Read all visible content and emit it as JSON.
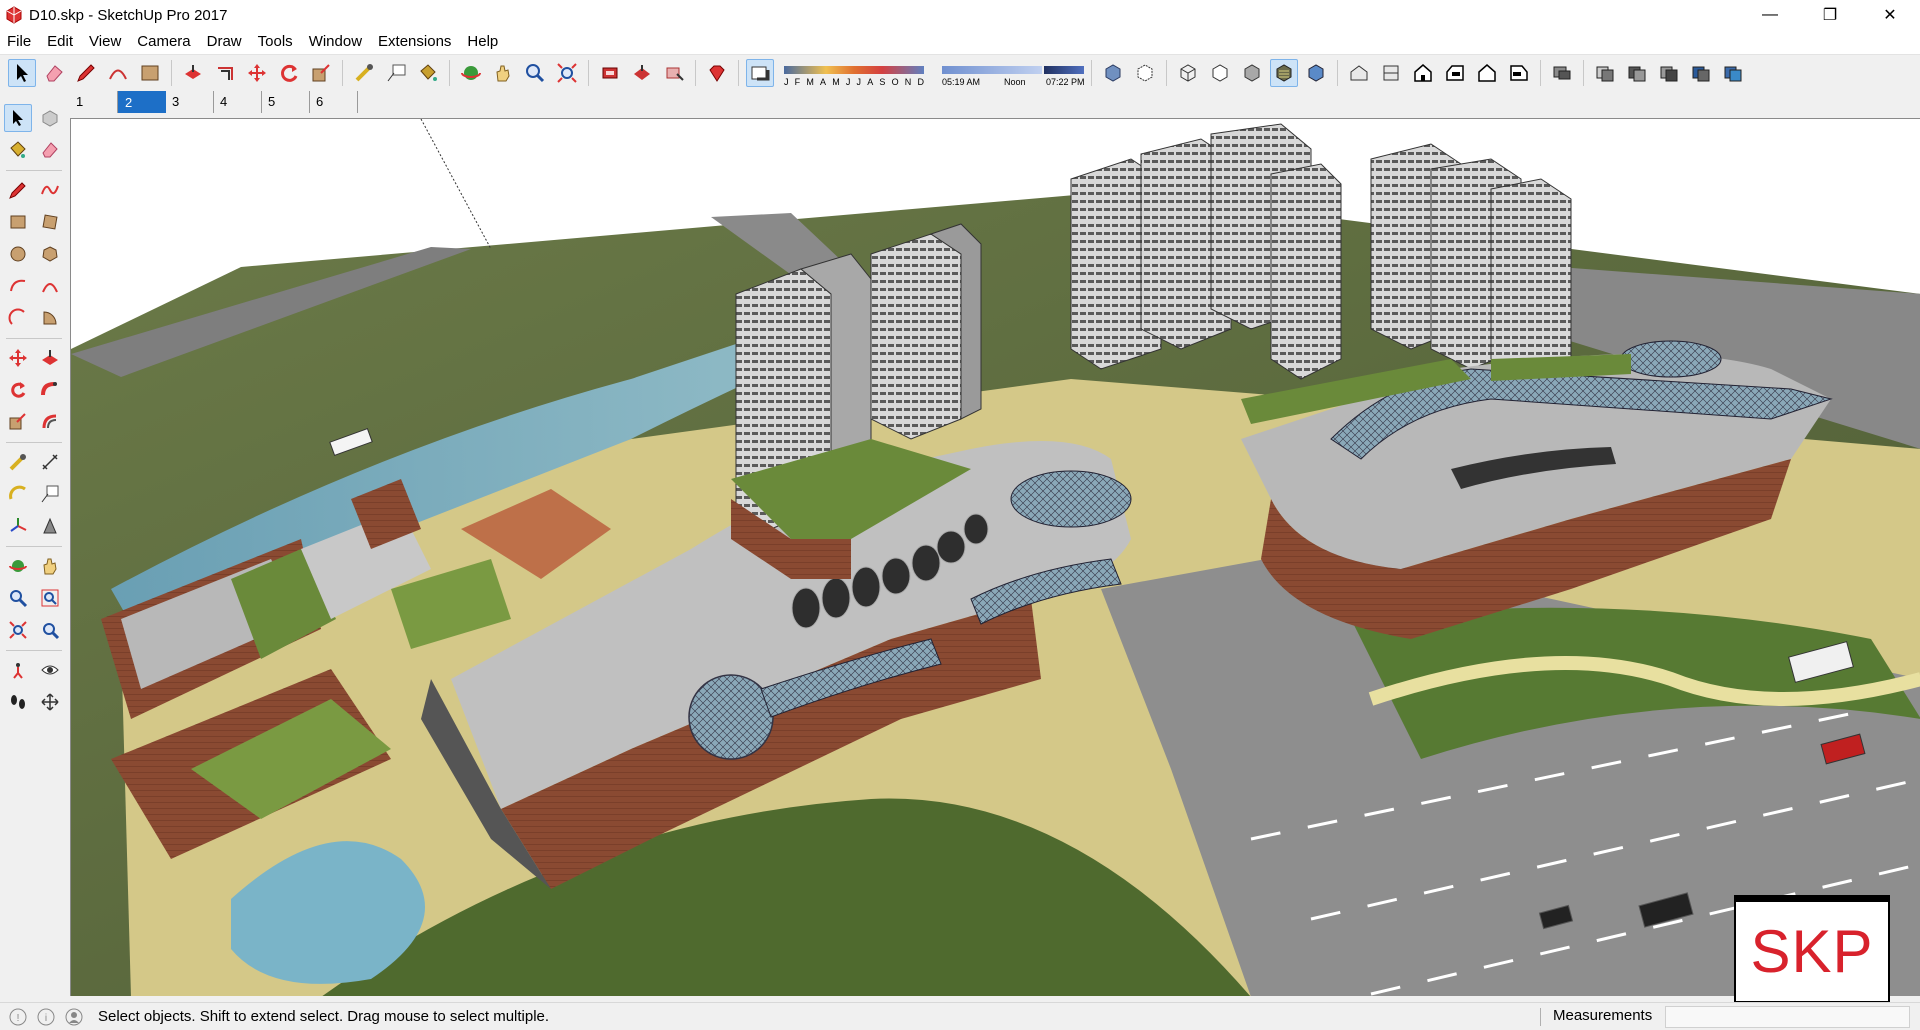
{
  "window": {
    "title": "D10.skp - SketchUp Pro 2017",
    "controls": {
      "minimize": "—",
      "restore": "❐",
      "close": "✕"
    }
  },
  "menu": [
    "File",
    "Edit",
    "View",
    "Camera",
    "Draw",
    "Tools",
    "Window",
    "Extensions",
    "Help"
  ],
  "toolbar": {
    "months": [
      "J",
      "F",
      "M",
      "A",
      "M",
      "J",
      "J",
      "A",
      "S",
      "O",
      "N",
      "D"
    ],
    "time_start": "05:19 AM",
    "time_mid": "Noon",
    "time_end": "07:22 PM"
  },
  "scenes": {
    "tabs": [
      "1",
      "2",
      "3",
      "4",
      "5",
      "6"
    ],
    "active_index": 1
  },
  "status": {
    "hint": "Select objects. Shift to extend select. Drag mouse to select multiple.",
    "measurements_label": "Measurements",
    "measurements_value": ""
  },
  "badge": {
    "text": "SKP"
  },
  "colors": {
    "accent": "#1d6fc7",
    "badge_red": "#d8222c",
    "grass": "#5a6b3a",
    "road": "#8c8c8c",
    "brick": "#8a4a32"
  }
}
